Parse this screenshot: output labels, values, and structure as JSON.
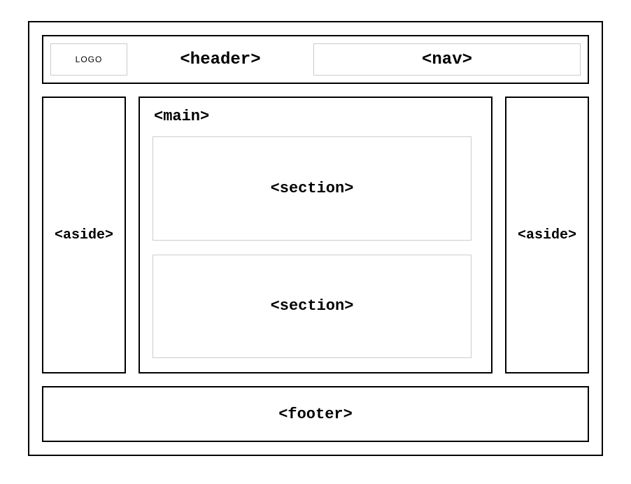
{
  "header": {
    "logo_text": "LOGO",
    "header_label": "<header>",
    "nav_label": "<nav>"
  },
  "aside_left_label": "<aside>",
  "aside_right_label": "<aside>",
  "main": {
    "label": "<main>",
    "sections": [
      {
        "label": "<section>"
      },
      {
        "label": "<section>"
      }
    ]
  },
  "footer_label": "<footer>"
}
